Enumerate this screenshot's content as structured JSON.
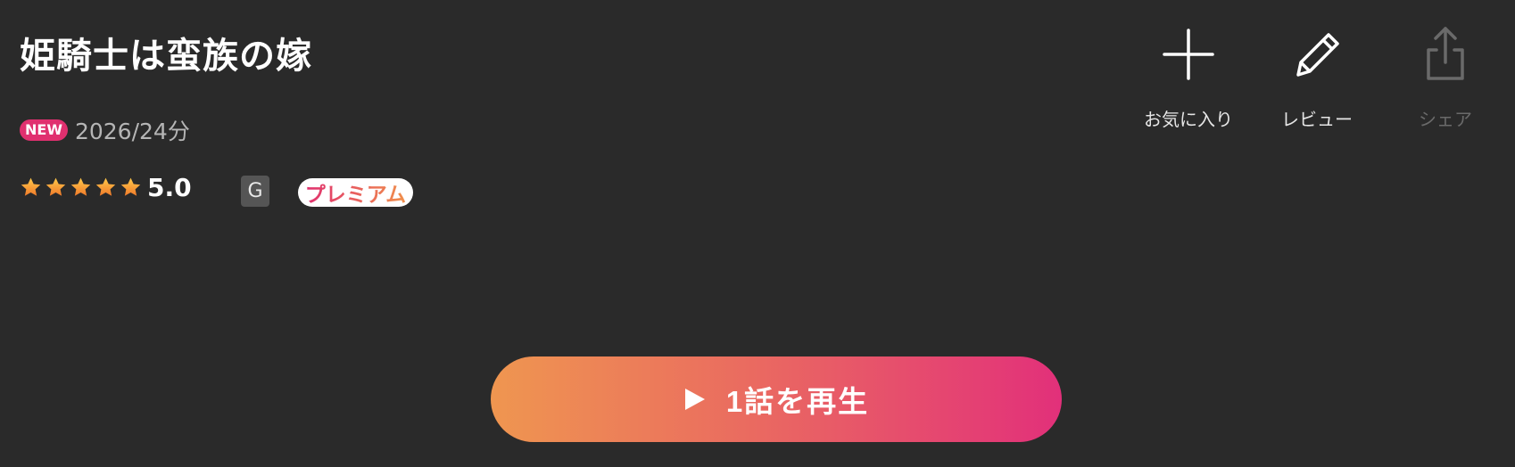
{
  "title": "姫騎士は蛮族の嫁",
  "meta": {
    "new_badge": "NEW",
    "year_duration": "2026/24分"
  },
  "rating": {
    "stars": 5,
    "value": "5.0"
  },
  "age_rating": "G",
  "premium_label": "プレミアム",
  "actions": {
    "favorite_label": "お気に入り",
    "review_label": "レビュー",
    "share_label": "シェア"
  },
  "play_button": {
    "label": "1話を再生"
  },
  "colors": {
    "background": "#2a2a2a",
    "accent_pink": "#e0306f",
    "accent_orange": "#ef9650",
    "star": "#f5a623"
  }
}
